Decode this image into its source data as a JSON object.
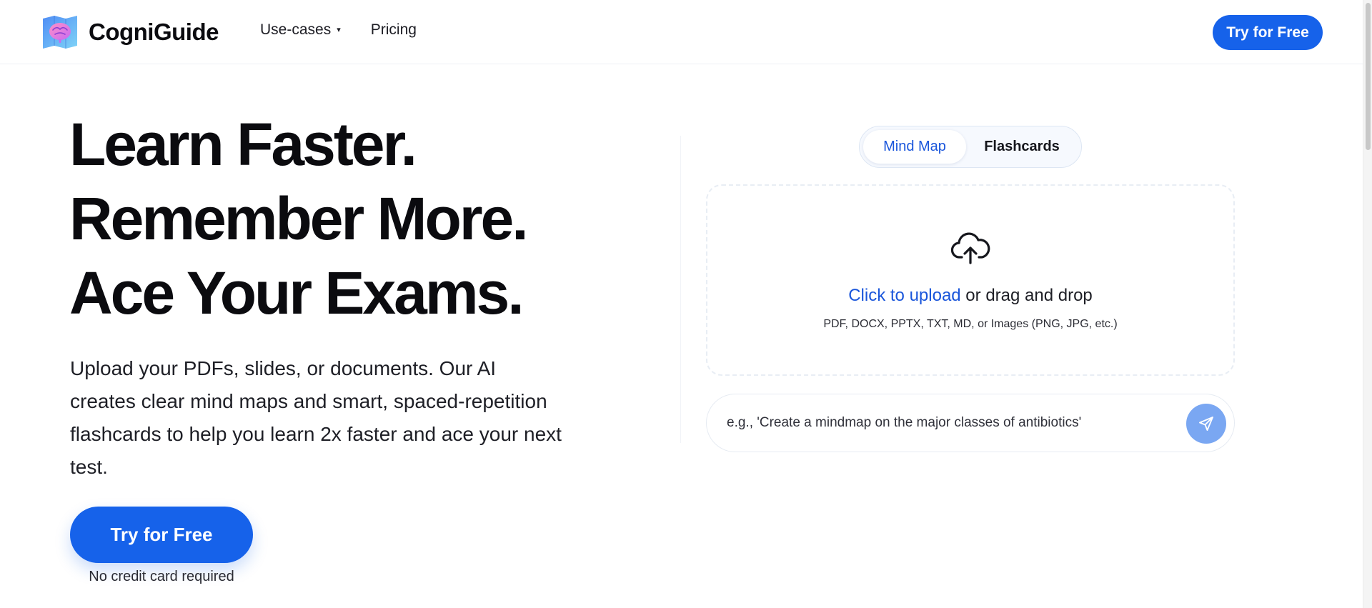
{
  "brand": {
    "name": "CogniGuide",
    "logo_icon": "brain-logo-icon",
    "accent_color": "#1662ea"
  },
  "nav": {
    "use_cases_label": "Use-cases",
    "use_cases_icon": "caret-down-icon",
    "pricing_label": "Pricing"
  },
  "header": {
    "cta_label": "Try for Free"
  },
  "hero": {
    "title_lines": [
      "Learn Faster.",
      "Remember More.",
      "Ace Your Exams."
    ],
    "description": "Upload your PDFs, slides, or documents. Our AI creates clear mind maps and smart, spaced-repetition flashcards to help you learn 2x faster and ace your next test.",
    "cta_label": "Try for Free",
    "cta_note": "No credit card required"
  },
  "tool": {
    "tabs": [
      {
        "label": "Mind Map",
        "active": true
      },
      {
        "label": "Flashcards",
        "active": false
      }
    ],
    "upload": {
      "icon": "cloud-upload-icon",
      "link_text": "Click to upload",
      "rest_text": " or drag and drop",
      "formats": "PDF, DOCX, PPTX, TXT, MD, or Images (PNG, JPG, etc.)"
    },
    "prompt": {
      "placeholder": "e.g., 'Create a mindmap on the major classes of antibiotics'",
      "value": "",
      "send_icon": "send-icon"
    }
  }
}
